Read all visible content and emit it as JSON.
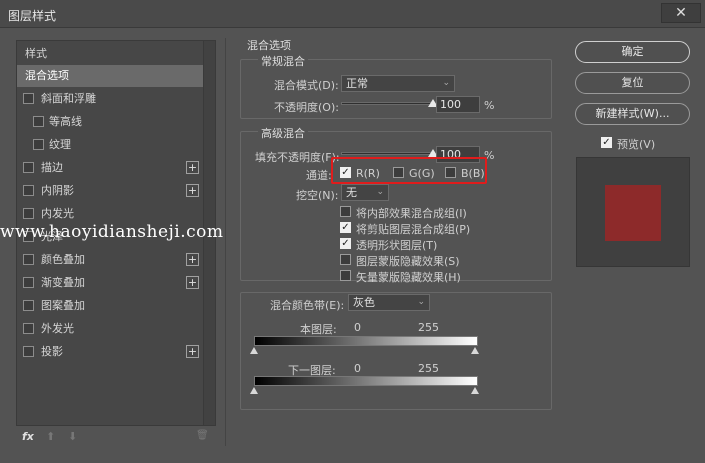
{
  "window": {
    "title": "图层样式",
    "close_glyph": "✕"
  },
  "left": {
    "header": "样式",
    "items": [
      {
        "label": "混合选项",
        "checkbox": false,
        "plus": false,
        "selected": true
      },
      {
        "label": "斜面和浮雕",
        "checkbox": true,
        "plus": false
      },
      {
        "label": "等高线",
        "checkbox": true,
        "plus": false
      },
      {
        "label": "纹理",
        "checkbox": true,
        "plus": false
      },
      {
        "label": "描边",
        "checkbox": true,
        "plus": true
      },
      {
        "label": "内阴影",
        "checkbox": true,
        "plus": true
      },
      {
        "label": "内发光",
        "checkbox": true,
        "plus": false
      },
      {
        "label": "光泽",
        "checkbox": true,
        "plus": false
      },
      {
        "label": "颜色叠加",
        "checkbox": true,
        "plus": true
      },
      {
        "label": "渐变叠加",
        "checkbox": true,
        "plus": true
      },
      {
        "label": "图案叠加",
        "checkbox": true,
        "plus": false
      },
      {
        "label": "外发光",
        "checkbox": true,
        "plus": false
      },
      {
        "label": "投影",
        "checkbox": true,
        "plus": true
      }
    ],
    "plus_glyph": "+",
    "toolbar": {
      "fx": "fx",
      "up": "⬆",
      "down": "⬇",
      "trash": "🗑"
    }
  },
  "blend": {
    "section_title": "混合选项",
    "general_title": "常规混合",
    "mode_label": "混合模式(D):",
    "mode_value": "正常",
    "opacity_label": "不透明度(O):",
    "opacity_value": "100",
    "opacity_unit": "%",
    "opacity_level": 1.0,
    "advanced_title": "高级混合",
    "fill_label": "填充不透明度(F):",
    "fill_value": "100",
    "fill_unit": "%",
    "fill_level": 1.0,
    "channels_label": "通道:",
    "channel_r": "R(R)",
    "channel_g": "G(G)",
    "channel_b": "B(B)",
    "knockout_label": "挖空(N):",
    "knockout_value": "无",
    "options": [
      {
        "label": "将内部效果混合成组(I)",
        "checked": false
      },
      {
        "label": "将剪贴图层混合成组(P)",
        "checked": true
      },
      {
        "label": "透明形状图层(T)",
        "checked": true
      },
      {
        "label": "图层蒙版隐藏效果(S)",
        "checked": false
      },
      {
        "label": "矢量蒙版隐藏效果(H)",
        "checked": false
      }
    ],
    "blend_if_label": "混合颜色带(E):",
    "blend_if_value": "灰色",
    "this_layer_label": "本图层:",
    "this_layer_min": "0",
    "this_layer_max": "255",
    "under_layer_label": "下一图层:",
    "under_layer_min": "0",
    "under_layer_max": "255",
    "check_glyph": "✓",
    "arrow_glyph": "⌄"
  },
  "right": {
    "ok": "确定",
    "reset": "复位",
    "new_style": "新建样式(W)...",
    "preview_label": "预览(V)",
    "preview_color": "#8d2a2a"
  },
  "watermark": "www.haoyidiansheji.com"
}
